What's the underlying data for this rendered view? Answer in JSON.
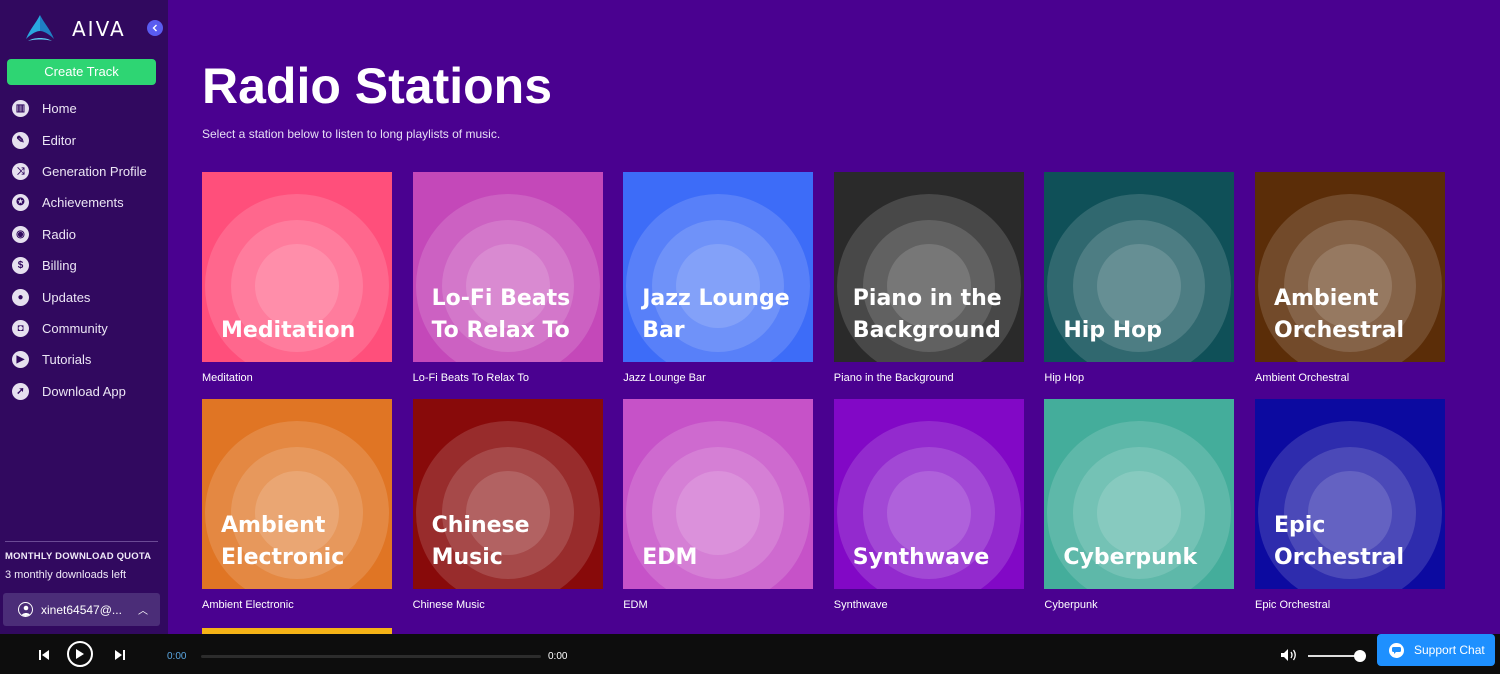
{
  "app": {
    "name": "AIVA"
  },
  "sidebar": {
    "create_label": "Create Track",
    "items": [
      {
        "label": "Home",
        "icon": "home-icon",
        "glyph": "▥"
      },
      {
        "label": "Editor",
        "icon": "pencil-icon",
        "glyph": "✎"
      },
      {
        "label": "Generation Profile",
        "icon": "shuffle-icon",
        "glyph": "⤨"
      },
      {
        "label": "Achievements",
        "icon": "medal-icon",
        "glyph": "✪"
      },
      {
        "label": "Radio",
        "icon": "radio-icon",
        "glyph": "◉"
      },
      {
        "label": "Billing",
        "icon": "dollar-icon",
        "glyph": "$"
      },
      {
        "label": "Updates",
        "icon": "updates-icon",
        "glyph": "●"
      },
      {
        "label": "Community",
        "icon": "discord-icon",
        "glyph": "◘"
      },
      {
        "label": "Tutorials",
        "icon": "play-icon",
        "glyph": "▶"
      },
      {
        "label": "Download App",
        "icon": "download-icon",
        "glyph": "➚"
      }
    ],
    "quota_title": "MONTHLY DOWNLOAD QUOTA",
    "quota_text": "3 monthly downloads left",
    "user_label": "xinet64547@..."
  },
  "main": {
    "title": "Radio Stations",
    "subtitle": "Select a station below to listen to long playlists of music."
  },
  "stations": [
    {
      "title": "Meditation",
      "caption": "Meditation",
      "color": "#ff4f7b"
    },
    {
      "title": "Lo-Fi Beats To Relax To",
      "caption": "Lo-Fi Beats To Relax To",
      "color": "#c448b9"
    },
    {
      "title": "Jazz Lounge Bar",
      "caption": "Jazz Lounge Bar",
      "color": "#3d6cf8"
    },
    {
      "title": "Piano in the Background",
      "caption": "Piano in the Background",
      "color": "#2a2a2a"
    },
    {
      "title": "Hip Hop",
      "caption": "Hip Hop",
      "color": "#0f5058"
    },
    {
      "title": "Ambient Orchestral",
      "caption": "Ambient Orchestral",
      "color": "#5b2d08"
    },
    {
      "title": "Ambient Electronic",
      "caption": "Ambient Electronic",
      "color": "#e07524"
    },
    {
      "title": "Chinese Music",
      "caption": "Chinese Music",
      "color": "#880a0a"
    },
    {
      "title": "EDM",
      "caption": "EDM",
      "color": "#c652c8"
    },
    {
      "title": "Synthwave",
      "caption": "Synthwave",
      "color": "#8208c6"
    },
    {
      "title": "Cyberpunk",
      "caption": "Cyberpunk",
      "color": "#44ad9b"
    },
    {
      "title": "Epic Orchestral",
      "caption": "Epic Orchestral",
      "color": "#0c0aa0"
    }
  ],
  "player": {
    "time_current": "0:00",
    "time_total": "0:00",
    "progress": 0,
    "volume": 0.88,
    "support_label": "Support Chat"
  },
  "colors": {
    "background": "#4a0190",
    "sidebar": "#31095f",
    "accent_green": "#2ed573",
    "support_blue": "#1e90ff"
  }
}
